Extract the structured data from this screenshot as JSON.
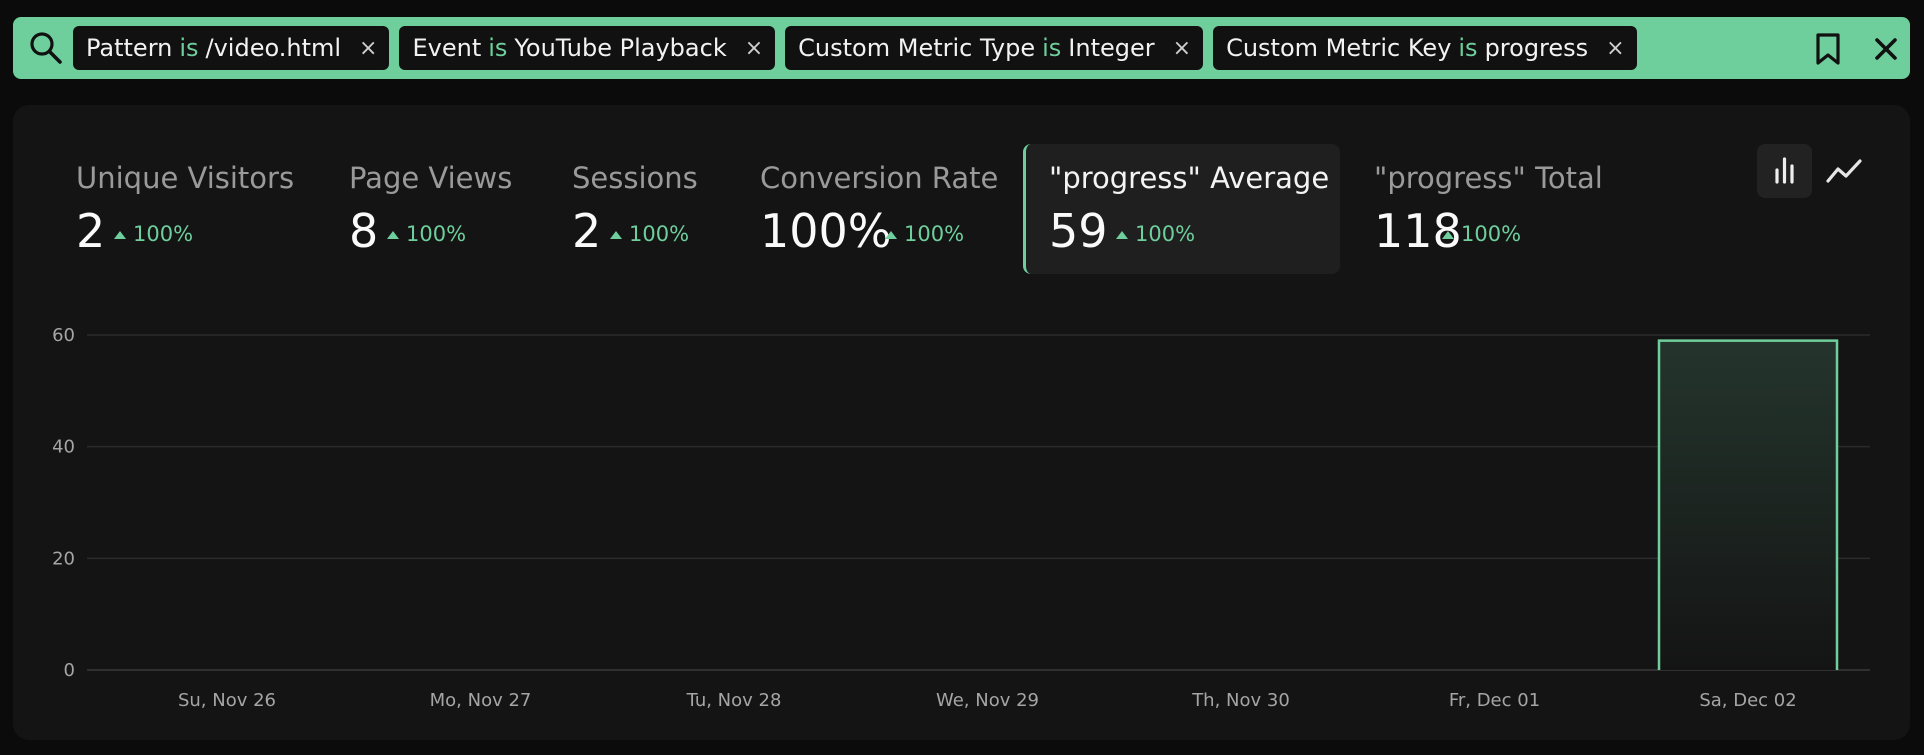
{
  "filters": [
    {
      "field": "Pattern",
      "op": "is",
      "value": "/video.html"
    },
    {
      "field": "Event",
      "op": "is",
      "value": "YouTube Playback"
    },
    {
      "field": "Custom Metric Type",
      "op": "is",
      "value": "Integer"
    },
    {
      "field": "Custom Metric Key",
      "op": "is",
      "value": "progress"
    }
  ],
  "icons": {
    "search": "search-icon",
    "bookmark": "bookmark-icon",
    "clear": "close-icon",
    "chip_remove": "×"
  },
  "metrics": [
    {
      "label": "Unique Visitors",
      "value": "2",
      "delta": "100%"
    },
    {
      "label": "Page Views",
      "value": "8",
      "delta": "100%"
    },
    {
      "label": "Sessions",
      "value": "2",
      "delta": "100%"
    },
    {
      "label": "Conversion Rate",
      "value": "100%",
      "delta": "100%"
    },
    {
      "label": "\"progress\" Average",
      "value": "59",
      "delta": "100%",
      "active": true
    },
    {
      "label": "\"progress\" Total",
      "value": "118",
      "delta": "100%"
    }
  ],
  "chart_toggle": {
    "selected": "bar",
    "options": [
      "bar-chart-icon",
      "line-chart-icon"
    ]
  },
  "colors": {
    "accent": "#6fcf9c",
    "background": "#0b0b0b",
    "panel": "#141414"
  },
  "chart_data": {
    "type": "bar",
    "categories": [
      "Su, Nov 26",
      "Mo, Nov 27",
      "Tu, Nov 28",
      "We, Nov 29",
      "Th, Nov 30",
      "Fr, Dec 01",
      "Sa, Dec 02"
    ],
    "values": [
      0,
      0,
      0,
      0,
      0,
      0,
      59
    ],
    "yticks": [
      0,
      20,
      40,
      60
    ],
    "ylim": [
      0,
      60
    ],
    "grid": true,
    "xlabel": "",
    "ylabel": ""
  }
}
